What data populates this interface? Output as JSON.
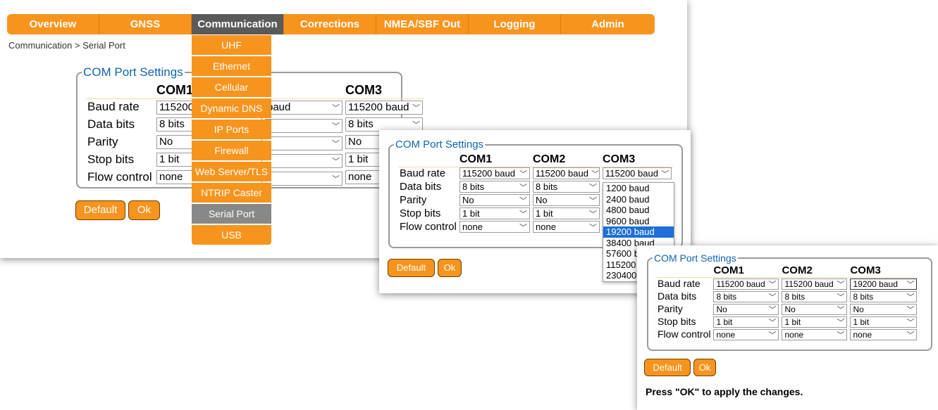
{
  "nav": {
    "items": [
      "Overview",
      "GNSS",
      "Communication",
      "Corrections",
      "NMEA/SBF Out",
      "Logging",
      "Admin"
    ],
    "active": "Communication"
  },
  "breadcrumb": "Communication > Serial Port",
  "submenu": {
    "items": [
      "UHF",
      "Ethernet",
      "Cellular",
      "Dynamic DNS",
      "IP Ports",
      "Firewall",
      "Web Server/TLS",
      "NTRIP Caster",
      "Serial Port",
      "USB"
    ],
    "active": "Serial Port"
  },
  "legend": "COM Port Settings",
  "columns": {
    "com1": "COM1",
    "com2": "COM2",
    "com3": "COM3"
  },
  "rows": {
    "baud": "Baud rate",
    "data": "Data bits",
    "parity": "Parity",
    "stop": "Stop bits",
    "flow": "Flow control"
  },
  "panel1": {
    "com1": {
      "baud": "115200",
      "data": "8 bits",
      "parity": "No",
      "stop": "1 bit",
      "flow": "none"
    },
    "com2": {
      "baud": "baud",
      "data": "",
      "parity": "",
      "stop": "",
      "flow": ""
    },
    "com3": {
      "baud": "115200 baud",
      "data": "8 bits",
      "parity": "No",
      "stop": "1 bit",
      "flow": "none"
    }
  },
  "panel2": {
    "com1": {
      "baud": "115200 baud",
      "data": "8 bits",
      "parity": "No",
      "stop": "1 bit",
      "flow": "none"
    },
    "com2": {
      "baud": "115200 baud",
      "data": "8 bits",
      "parity": "No",
      "stop": "1 bit",
      "flow": "none"
    },
    "com3": {
      "baud": "115200 baud"
    },
    "baud_options": [
      "1200 baud",
      "2400 baud",
      "4800 baud",
      "9600 baud",
      "19200 baud",
      "38400 baud",
      "57600 b",
      "115200",
      "230400"
    ],
    "highlighted_option": "19200 baud"
  },
  "panel3": {
    "com1": {
      "baud": "115200 baud",
      "data": "8 bits",
      "parity": "No",
      "stop": "1 bit",
      "flow": "none"
    },
    "com2": {
      "baud": "115200 baud",
      "data": "8 bits",
      "parity": "No",
      "stop": "1 bit",
      "flow": "none"
    },
    "com3": {
      "baud": "19200 baud",
      "data": "8 bits",
      "parity": "No",
      "stop": "1 bit",
      "flow": "none"
    }
  },
  "buttons": {
    "default": "Default",
    "ok": "Ok"
  },
  "apply_message": "Press \"OK\" to apply the changes.",
  "colors": {
    "accent": "#f7941d",
    "active_tab": "#5a5a5a",
    "legend": "#0e63b0",
    "highlight": "#1e6fd9"
  },
  "icons": {
    "select_arrow": "chevron-down-icon"
  }
}
